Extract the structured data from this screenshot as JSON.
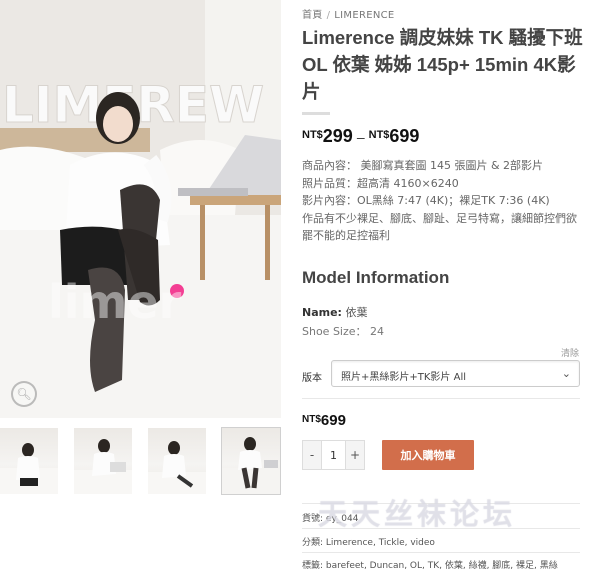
{
  "breadcrumb": {
    "home": "首頁",
    "separator": "/",
    "category": "LIMERENCE"
  },
  "product": {
    "title": "Limerence 調皮妹妹 TK 騷擾下班 OL 依葉 姊姊 145p+ 15min 4K影片",
    "price_range": {
      "currency": "NT$",
      "min": "299",
      "dash": "–",
      "max": "699"
    },
    "description": [
      "商品內容： 美腳寫真套圖 145 張圖片 & 2部影片",
      "照片品質：超高清 4160×6240",
      "影片內容：OL黑絲 7:47 (4K)；裸足TK 7:36 (4K)",
      "作品有不少裸足、腳底、腳趾、足弓特寫，讓細節控們欲罷不能的足控福利"
    ]
  },
  "model_info": {
    "heading": "Model Information",
    "name_label": "Name:",
    "name_value": "依葉",
    "shoe_size": "Shoe Size： 24"
  },
  "variation": {
    "clear_label": "清除",
    "label": "版本",
    "selected": "照片+黑絲影片+TK影片 All",
    "price": {
      "currency": "NT$",
      "amount": "699"
    }
  },
  "cart": {
    "minus": "-",
    "quantity": "1",
    "plus": "+",
    "add_to_cart": "加入購物車"
  },
  "meta": {
    "sku_label": "貨號:",
    "sku_value": "ey_044",
    "categories_label": "分類:",
    "categories_value": "Limerence, Tickle, video",
    "tags_label": "標籤:",
    "tags_value": "barefeet, Duncan, OL, TK, 依葉, 絲襪, 腳底, 裸足, 黑絲"
  },
  "watermark": "天天丝袜论坛",
  "photo_overlay_text": "LIMEREW",
  "photo_watermark": "limer",
  "colors": {
    "accent_button": "#d26e4b",
    "title_text": "#444444",
    "price_text": "#111111"
  },
  "icons": {
    "zoom": "magnifier-icon",
    "select": "chevron-down-icon"
  }
}
